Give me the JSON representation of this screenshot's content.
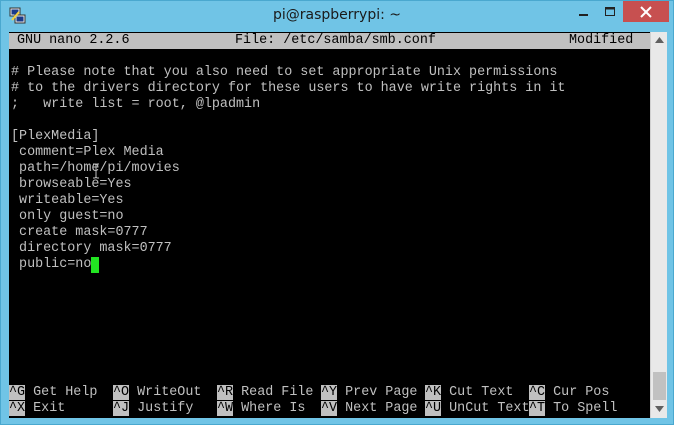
{
  "window": {
    "title": "pi@raspberrypi: ~",
    "icon": "putty-icon"
  },
  "nano": {
    "version": "GNU nano 2.2.6",
    "file": "File: /etc/samba/smb.conf",
    "status": "Modified"
  },
  "lines": [
    "",
    "# Please note that you also need to set appropriate Unix permissions",
    "# to the drivers directory for these users to have write rights in it",
    ";   write list = root, @lpadmin",
    "",
    "[PlexMedia]",
    " comment=Plex Media",
    " path=/home/pi/movies",
    " browseable=Yes",
    " writeable=Yes",
    " only guest=no",
    " create mask=0777",
    " directory mask=0777",
    " public=no"
  ],
  "shortcuts": [
    {
      "key": "^G",
      "label": "Get Help"
    },
    {
      "key": "^O",
      "label": "WriteOut"
    },
    {
      "key": "^R",
      "label": "Read File"
    },
    {
      "key": "^Y",
      "label": "Prev Page"
    },
    {
      "key": "^K",
      "label": "Cut Text"
    },
    {
      "key": "^C",
      "label": "Cur Pos"
    },
    {
      "key": "^X",
      "label": "Exit"
    },
    {
      "key": "^J",
      "label": "Justify"
    },
    {
      "key": "^W",
      "label": "Where Is"
    },
    {
      "key": "^V",
      "label": "Next Page"
    },
    {
      "key": "^U",
      "label": "UnCut Text"
    },
    {
      "key": "^T",
      "label": "To Spell"
    }
  ],
  "colors": {
    "titlebar": "#70c4e6",
    "close_button": "#c75050",
    "terminal_bg": "#000000",
    "terminal_fg": "#c0c0c0",
    "cursor": "#22e422"
  }
}
